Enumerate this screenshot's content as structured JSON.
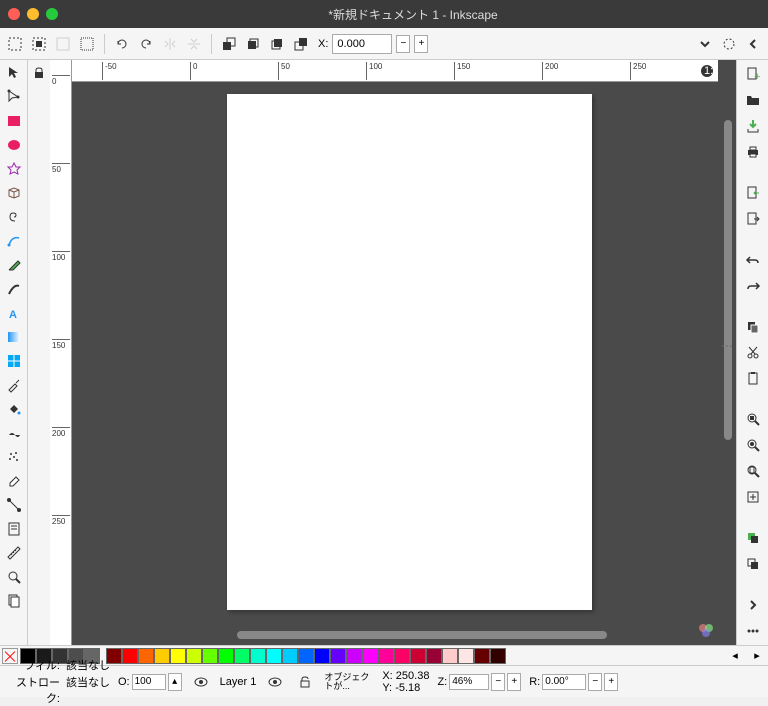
{
  "title": "*新規ドキュメント 1 - Inkscape",
  "toolbar": {
    "x_label": "X:",
    "x_value": "0.000"
  },
  "ruler_h": [
    "-50",
    "0",
    "50",
    "100",
    "150",
    "200",
    "250"
  ],
  "ruler_v": [
    "0",
    "50",
    "100",
    "150",
    "200",
    "250"
  ],
  "status": {
    "fill_label": "フィル:",
    "stroke_label": "ストローク:",
    "fill_value": "該当なし",
    "stroke_value": "該当なし",
    "opacity_label": "O:",
    "opacity_value": "100",
    "layer": "Layer 1",
    "hint": "オブジェクトが...",
    "x_label": "X:",
    "y_label": "Y:",
    "x_val": "250.38",
    "y_val": "-5.18",
    "z_label": "Z:",
    "zoom": "46%",
    "r_label": "R:",
    "rotation": "0.00°"
  },
  "palette_grays": [
    "#000000",
    "#1a1a1a",
    "#333333",
    "#4d4d4d",
    "#666666"
  ],
  "palette_colors": [
    "#800000",
    "#ff0000",
    "#ff6600",
    "#ffcc00",
    "#ffff00",
    "#ccff00",
    "#66ff00",
    "#00ff00",
    "#00ff66",
    "#00ffcc",
    "#00ffff",
    "#00ccff",
    "#0066ff",
    "#0000ff",
    "#6600ff",
    "#cc00ff",
    "#ff00ff",
    "#ff0099",
    "#ff0066",
    "#cc0033",
    "#990033",
    "#ffcccc",
    "#ffe6e6",
    "#660000",
    "#330000"
  ]
}
